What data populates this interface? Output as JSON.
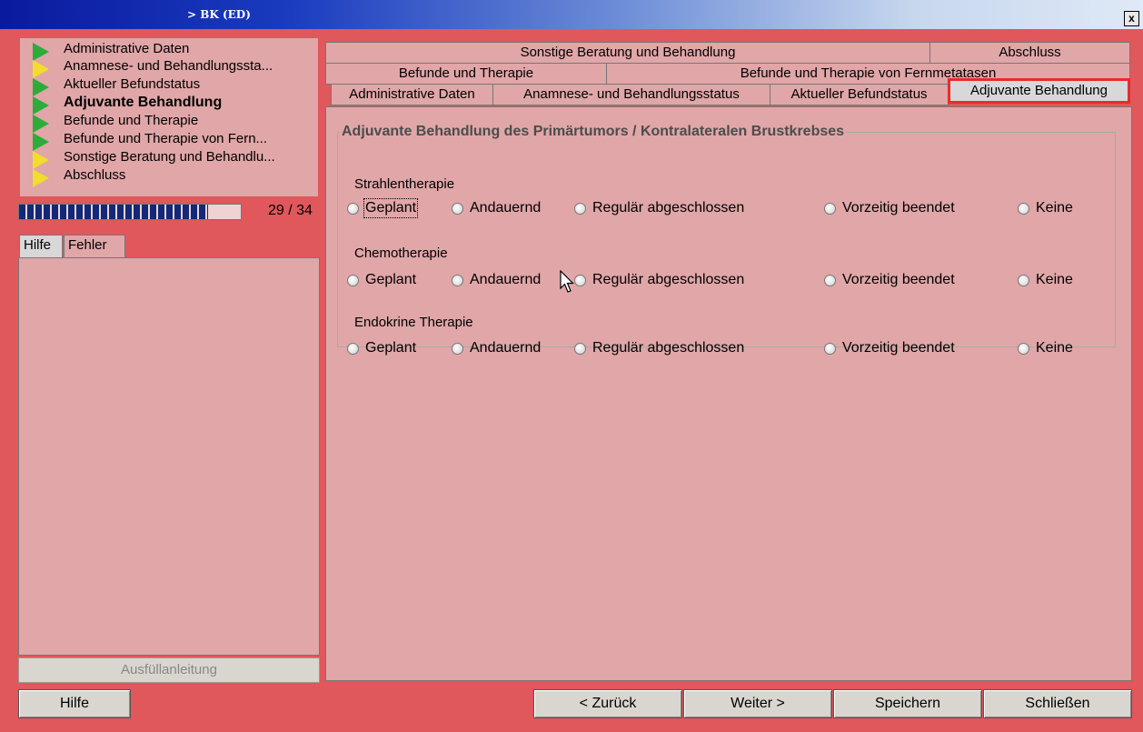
{
  "window": {
    "title": "> BK (ED)",
    "close_label": "x"
  },
  "nav": {
    "items": [
      {
        "label": "Administrative Daten",
        "status": "green"
      },
      {
        "label": "Anamnese- und Behandlungssta...",
        "status": "yellow"
      },
      {
        "label": "Aktueller Befundstatus",
        "status": "green"
      },
      {
        "label": "Adjuvante Behandlung",
        "status": "green"
      },
      {
        "label": "Befunde und Therapie",
        "status": "green"
      },
      {
        "label": "Befunde und Therapie von Fern...",
        "status": "green"
      },
      {
        "label": "Sonstige Beratung und Behandlu...",
        "status": "yellow"
      },
      {
        "label": "Abschluss",
        "status": "yellow"
      }
    ],
    "active_index": 3
  },
  "progress": {
    "text": "29 / 34",
    "current": 29,
    "total": 34
  },
  "side_tabs": {
    "help": "Hilfe",
    "errors": "Fehler"
  },
  "fill_guide_label": "Ausfüllanleitung",
  "tabs": {
    "row1": [
      "Sonstige Beratung und Behandlung",
      "Abschluss"
    ],
    "row2": [
      "Befunde und Therapie",
      "Befunde und Therapie von Fernmetatasen"
    ],
    "row3": [
      "Administrative Daten",
      "Anamnese- und Behandlungsstatus",
      "Aktueller Befundstatus",
      "Adjuvante Behandlung"
    ]
  },
  "form": {
    "group_title": "Adjuvante Behandlung des Primärtumors / Kontralateralen Brustkrebses",
    "sections": [
      {
        "label": "Strahlentherapie"
      },
      {
        "label": "Chemotherapie"
      },
      {
        "label": "Endokrine Therapie"
      }
    ],
    "options": [
      "Geplant",
      "Andauernd",
      "Regulär abgeschlossen",
      "Vorzeitig beendet",
      "Keine"
    ]
  },
  "buttons": {
    "help": "Hilfe",
    "back": "< Zurück",
    "next": "Weiter >",
    "save": "Speichern",
    "close": "Schließen"
  },
  "colors": {
    "window_bg": "#e0575c",
    "panel_bg": "#e0a6a8",
    "progress_fill": "#122878",
    "highlight": "#ea2b2b",
    "status_green": "#2dac3a",
    "status_yellow": "#f2dc2c"
  }
}
